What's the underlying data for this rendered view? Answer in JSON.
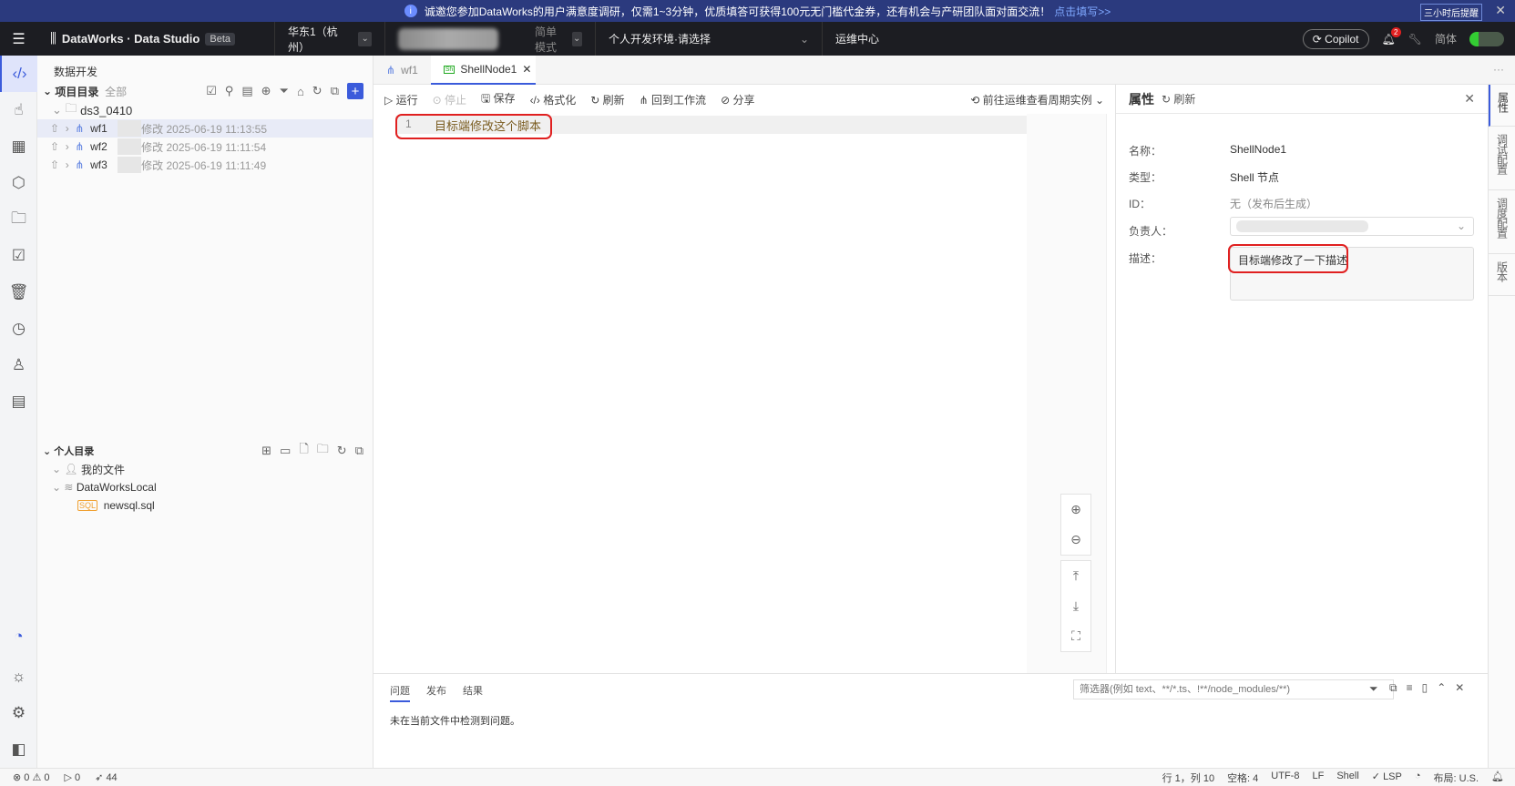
{
  "banner": {
    "text": "诚邀您参加DataWorks的用户满意度调研，仅需1~3分钟，优质填答可获得100元无门槛代金券，还有机会与产研团队面对面交流！",
    "link": "点击填写>>",
    "remind": "三小时后提醒"
  },
  "header": {
    "brand": "DataWorks · Data Studio",
    "badge": "Beta",
    "region": "华东1（杭州）",
    "mode": "简单模式",
    "env": "个人开发环境·请选择",
    "ops": "运维中心",
    "copilot": "Copilot",
    "notif_count": "2",
    "lang": "简体"
  },
  "sidebar": {
    "title": "数据开发",
    "project_dir": "项目目录",
    "all": "全部",
    "folder": "ds3_0410",
    "items": [
      {
        "name": "wf1",
        "meta": "修改 2025-06-19 11:13:55"
      },
      {
        "name": "wf2",
        "meta": "修改 2025-06-19 11:11:54"
      },
      {
        "name": "wf3",
        "meta": "修改 2025-06-19 11:11:49"
      }
    ],
    "personal_dir": "个人目录",
    "my_files": "我的文件",
    "local": "DataWorksLocal",
    "file": "newsql.sql"
  },
  "tabs": [
    {
      "label": "wf1"
    },
    {
      "label": "ShellNode1"
    }
  ],
  "toolbar": {
    "run": "运行",
    "stop": "停止",
    "save": "保存",
    "format": "格式化",
    "refresh": "刷新",
    "back": "回到工作流",
    "share": "分享",
    "goto_ops": "前往运维查看周期实例"
  },
  "editor": {
    "line_no": "1",
    "code": "目标端修改这个脚本"
  },
  "props": {
    "title": "属性",
    "refresh": "刷新",
    "name_label": "名称：",
    "name": "ShellNode1",
    "type_label": "类型：",
    "type": "Shell 节点",
    "id_label": "ID：",
    "id": "无（发布后生成）",
    "owner_label": "负责人：",
    "desc_label": "描述：",
    "desc": "目标端修改了一下描述"
  },
  "rail": [
    "属性",
    "调试配置",
    "调度配置",
    "版本"
  ],
  "bottom": {
    "tabs": [
      "问题",
      "发布",
      "结果"
    ],
    "filter_placeholder": "筛选器(例如 text、**/*.ts、!**/node_modules/**)",
    "message": "未在当前文件中检测到问题。"
  },
  "status": {
    "errors": "0",
    "warnings": "0",
    "run": "0",
    "sent": "44",
    "pos": "行 1，列 10",
    "spaces": "空格: 4",
    "enc": "UTF-8",
    "eol": "LF",
    "lang": "Shell",
    "lsp": "LSP",
    "layout": "布局: U.S."
  }
}
